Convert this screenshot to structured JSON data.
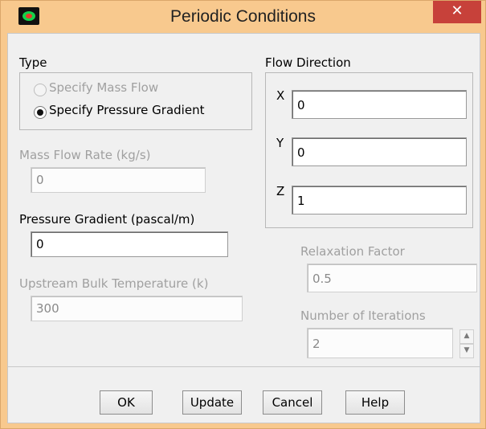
{
  "window": {
    "title": "Periodic Conditions",
    "close_label": "✕"
  },
  "type_group": {
    "label": "Type",
    "options": [
      {
        "label": "Specify Mass Flow",
        "selected": false,
        "enabled": false
      },
      {
        "label": "Specify Pressure Gradient",
        "selected": true,
        "enabled": true
      }
    ]
  },
  "mass_flow_rate": {
    "label": "Mass Flow Rate (kg/s)",
    "value": "0",
    "enabled": false
  },
  "pressure_gradient": {
    "label": "Pressure Gradient (pascal/m)",
    "value": "0",
    "enabled": true
  },
  "upstream_bulk_temperature": {
    "label": "Upstream Bulk Temperature (k)",
    "value": "300",
    "enabled": false
  },
  "flow_direction": {
    "label": "Flow Direction",
    "x": {
      "label": "X",
      "value": "0"
    },
    "y": {
      "label": "Y",
      "value": "0"
    },
    "z": {
      "label": "Z",
      "value": "1"
    }
  },
  "relaxation_factor": {
    "label": "Relaxation Factor",
    "value": "0.5",
    "enabled": false
  },
  "number_of_iterations": {
    "label": "Number of Iterations",
    "value": "2",
    "enabled": false
  },
  "buttons": {
    "ok": "OK",
    "update": "Update",
    "cancel": "Cancel",
    "help": "Help"
  },
  "colors": {
    "title_bar": "#f8c98e",
    "close_button": "#c7413a",
    "dialog_bg": "#f0f0f0"
  },
  "icons": {
    "app": "fluent-app-icon",
    "close": "close-icon",
    "spin_up": "spin-up-icon",
    "spin_down": "spin-down-icon"
  }
}
